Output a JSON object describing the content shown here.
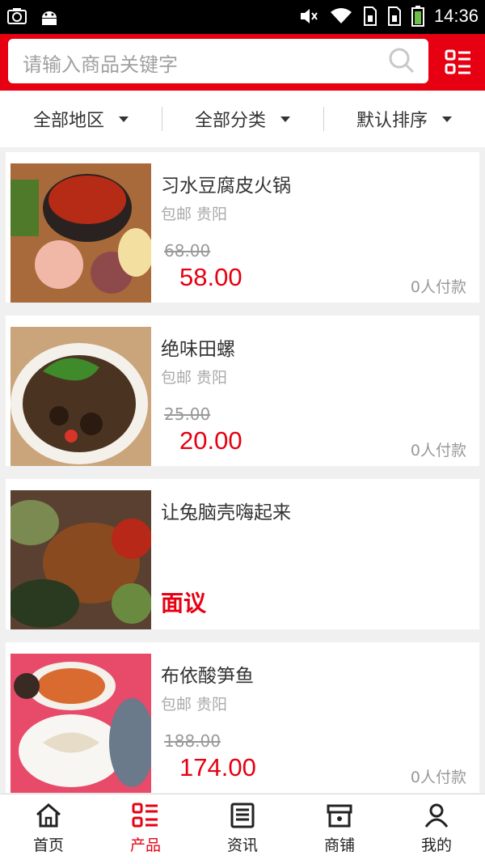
{
  "status_bar": {
    "time": "14:36"
  },
  "search": {
    "placeholder": "请输入商品关键字"
  },
  "filters": [
    {
      "label": "全部地区"
    },
    {
      "label": "全部分类"
    },
    {
      "label": "默认排序"
    }
  ],
  "products": [
    {
      "title": "习水豆腐皮火锅",
      "tags": "包邮 贵阳",
      "original_price": "68.00",
      "price": "58.00",
      "paid_count": "0人付款"
    },
    {
      "title": "绝味田螺",
      "tags": "包邮 贵阳",
      "original_price": "25.00",
      "price": "20.00",
      "paid_count": "0人付款"
    },
    {
      "title": "让兔脑壳嗨起来",
      "price_text": "面议"
    },
    {
      "title": "布依酸笋鱼",
      "tags": "包邮 贵阳",
      "original_price": "188.00",
      "price": "174.00",
      "paid_count": "0人付款"
    }
  ],
  "tabbar": [
    {
      "label": "首页",
      "icon": "home-icon"
    },
    {
      "label": "产品",
      "icon": "product-list-icon",
      "active": true
    },
    {
      "label": "资讯",
      "icon": "news-icon"
    },
    {
      "label": "商铺",
      "icon": "store-icon"
    },
    {
      "label": "我的",
      "icon": "user-icon"
    }
  ],
  "colors": {
    "brand": "#e60012",
    "background": "#f0f0f0",
    "text": "#333333",
    "muted": "#999999"
  }
}
